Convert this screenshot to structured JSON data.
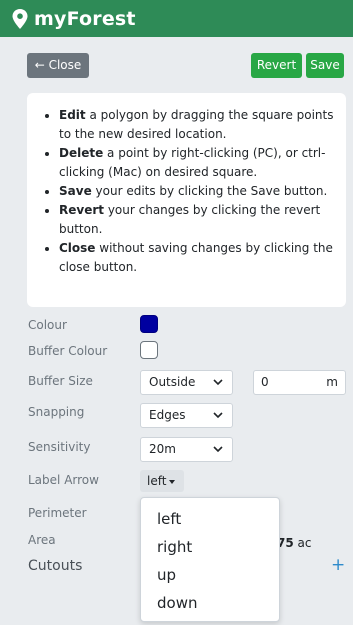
{
  "app": {
    "title": "myForest"
  },
  "toolbar": {
    "close_label": "← Close",
    "revert_label": "Revert",
    "save_label": "Save"
  },
  "help": {
    "items": [
      {
        "bold": "Edit",
        "text": " a polygon by dragging the square points to the new desired location."
      },
      {
        "bold": "Delete",
        "text": " a point by right-clicking (PC), or ctrl-clicking (Mac) on desired square."
      },
      {
        "bold": "Save",
        "text": " your edits by clicking the Save button."
      },
      {
        "bold": "Revert",
        "text": " your changes by clicking the revert button."
      },
      {
        "bold": "Close",
        "text": " without saving changes by clicking the close button."
      }
    ]
  },
  "form": {
    "colour_label": "Colour",
    "colour_value": "#0000a0",
    "buffer_colour_label": "Buffer Colour",
    "buffer_colour_value": "#ffffff",
    "buffer_size_label": "Buffer Size",
    "buffer_size_select": "Outside",
    "buffer_size_value": "0",
    "buffer_size_unit": "m",
    "snapping_label": "Snapping",
    "snapping_value": "Edges",
    "sensitivity_label": "Sensitivity",
    "sensitivity_value": "20m",
    "label_arrow_label": "Label Arrow",
    "label_arrow_value": "left",
    "perimeter_label": "Perimeter",
    "area_label": "Area",
    "area_value_bold": "75",
    "area_value_unit": " ac",
    "cutouts_label": "Cutouts",
    "cutouts_add": "+"
  },
  "menu": {
    "options": [
      "left",
      "right",
      "up",
      "down"
    ]
  }
}
